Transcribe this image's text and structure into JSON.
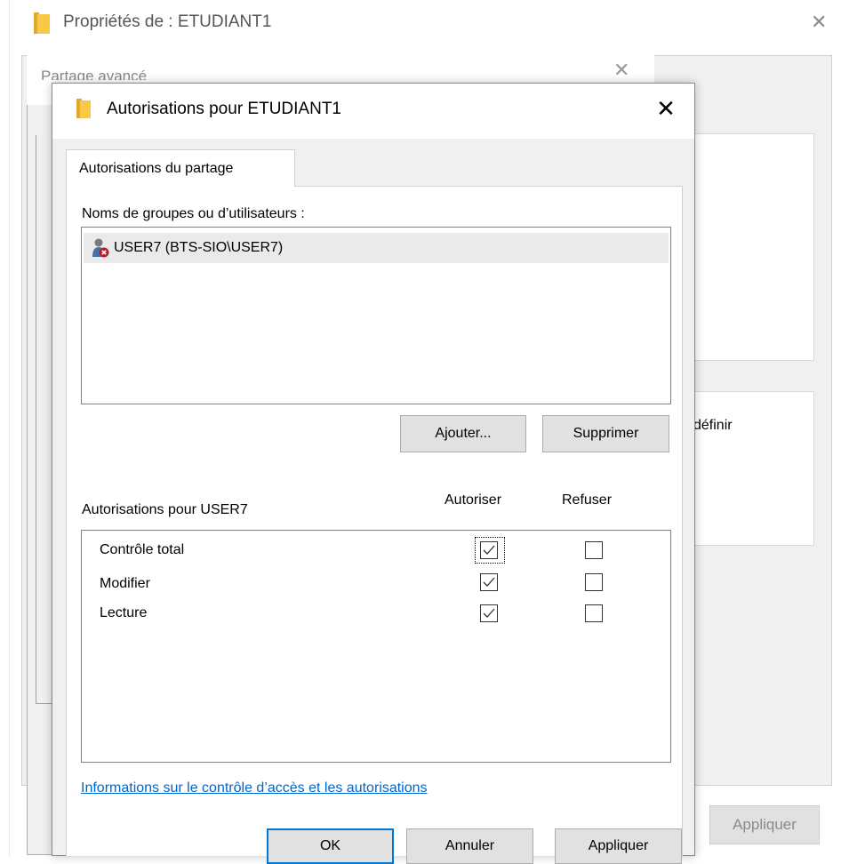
{
  "background_window": {
    "title": "Propriétés de : ETUDIANT1",
    "partial_text": "définir",
    "apply_label": "Appliquer"
  },
  "middle_dialog": {
    "title": "Partage avancé"
  },
  "dialog": {
    "title": "Autorisations pour ETUDIANT1",
    "close_symbol": "✕",
    "tab_label": "Autorisations du partage",
    "groups_label": "Noms de groupes ou d’utilisateurs :",
    "users": [
      {
        "name": "USER7 (BTS-SIO\\USER7)",
        "selected": true
      }
    ],
    "add_button": "Ajouter...",
    "remove_button": "Supprimer",
    "permissions_for_label": "Autorisations pour USER7",
    "allow_header": "Autoriser",
    "deny_header": "Refuser",
    "permissions": [
      {
        "name": "Contrôle total",
        "allow": true,
        "deny": false
      },
      {
        "name": "Modifier",
        "allow": true,
        "deny": false
      },
      {
        "name": "Lecture",
        "allow": true,
        "deny": false
      }
    ],
    "info_link": "Informations sur le contrôle d’accès et les autorisations",
    "ok_button": "OK",
    "cancel_button": "Annuler",
    "apply_button": "Appliquer"
  },
  "colors": {
    "link": "#0066cc",
    "focus_border": "#0078d7",
    "folder": "#f8c846"
  },
  "icons": [
    "folder-icon",
    "close-icon",
    "user-group-icon",
    "checkmark-icon"
  ]
}
